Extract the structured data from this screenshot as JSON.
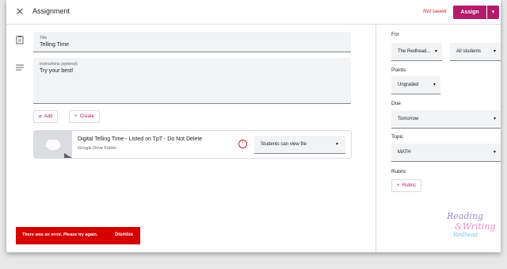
{
  "header": {
    "close_icon": "close-icon",
    "title": "Assignment",
    "status": "Not saved",
    "assign_label": "Assign",
    "accent_color": "#b31b6b"
  },
  "form": {
    "title_field": {
      "label": "Title",
      "value": "Telling Time"
    },
    "instructions_field": {
      "label": "Instructions (optional)",
      "value": "Try your best!"
    },
    "add_label": "Add",
    "create_label": "Create"
  },
  "attachment": {
    "title": "Digital Telling Time - Listed on TpT - Do Not Delete",
    "subtitle": "Google Drive Folder",
    "permission": "Students can view file",
    "warning_icon": "alert-icon"
  },
  "panel": {
    "for_label": "For",
    "class_value": "The Redhead...",
    "students_value": "All students",
    "points_label": "Points",
    "points_value": "Ungraded",
    "due_label": "Due",
    "due_value": "Tomorrow",
    "topic_label": "Topic",
    "topic_value": "MATH",
    "rubric_label": "Rubric",
    "rubric_button": "Rubric"
  },
  "snackbar": {
    "message": "There was an error. Please try again.",
    "action": "Dismiss",
    "color": "#d50000"
  }
}
